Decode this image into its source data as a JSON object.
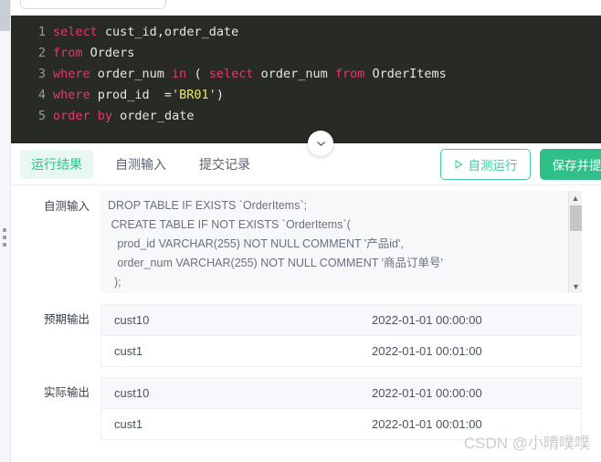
{
  "top": {
    "select_placeholder": ""
  },
  "editor": {
    "language": "sql",
    "lines": [
      {
        "num": "1",
        "tokens": [
          {
            "t": "select",
            "c": "kw"
          },
          {
            "t": " cust_id,order_date",
            "c": "ctxt"
          }
        ]
      },
      {
        "num": "2",
        "tokens": [
          {
            "t": "from",
            "c": "kw"
          },
          {
            "t": " Orders",
            "c": "ctxt"
          }
        ]
      },
      {
        "num": "3",
        "tokens": [
          {
            "t": "where",
            "c": "kw"
          },
          {
            "t": " order_num ",
            "c": "ctxt"
          },
          {
            "t": "in",
            "c": "kw"
          },
          {
            "t": " ( ",
            "c": "ctxt"
          },
          {
            "t": "select",
            "c": "kw"
          },
          {
            "t": " order_num ",
            "c": "ctxt"
          },
          {
            "t": "from",
            "c": "kw"
          },
          {
            "t": " OrderItems",
            "c": "ctxt"
          }
        ]
      },
      {
        "num": "4",
        "tokens": [
          {
            "t": "where",
            "c": "kw"
          },
          {
            "t": " prod_id  =",
            "c": "ctxt"
          },
          {
            "t": "'BR01'",
            "c": "str"
          },
          {
            "t": ")",
            "c": "ctxt"
          }
        ]
      },
      {
        "num": "5",
        "tokens": [
          {
            "t": "order",
            "c": "kw"
          },
          {
            "t": " ",
            "c": "ctxt"
          },
          {
            "t": "by",
            "c": "kw"
          },
          {
            "t": " order_date",
            "c": "ctxt"
          }
        ]
      }
    ]
  },
  "collapse": {
    "icon": "chevron-down-icon"
  },
  "toolbar": {
    "tabs": [
      {
        "label": "运行结果",
        "active": true
      },
      {
        "label": "自测输入",
        "active": false
      },
      {
        "label": "提交记录",
        "active": false
      }
    ],
    "run_label": "自测运行",
    "run_icon": "play-icon",
    "submit_label": "保存并提交",
    "accent_color": "#2fc08a",
    "accent_light": "#e8f8f1"
  },
  "results": {
    "input": {
      "label": "自测输入",
      "text": "DROP TABLE IF EXISTS `OrderItems`;\n CREATE TABLE IF NOT EXISTS `OrderItems`(\n   prod_id VARCHAR(255) NOT NULL COMMENT '产品id',\n   order_num VARCHAR(255) NOT NULL COMMENT '商品订单号'\n  );",
      "scrollbar": {
        "up_icon": "chevron-up-icon",
        "down_icon": "chevron-down-icon"
      }
    },
    "expected": {
      "label": "预期输出",
      "rows": [
        {
          "cust": "cust10",
          "date": "2022-01-01 00:00:00"
        },
        {
          "cust": "cust1",
          "date": "2022-01-01 00:01:00"
        }
      ]
    },
    "actual": {
      "label": "实际输出",
      "rows": [
        {
          "cust": "cust10",
          "date": "2022-01-01 00:00:00"
        },
        {
          "cust": "cust1",
          "date": "2022-01-01 00:01:00"
        }
      ]
    }
  },
  "watermark": "CSDN @小晴噗噗"
}
